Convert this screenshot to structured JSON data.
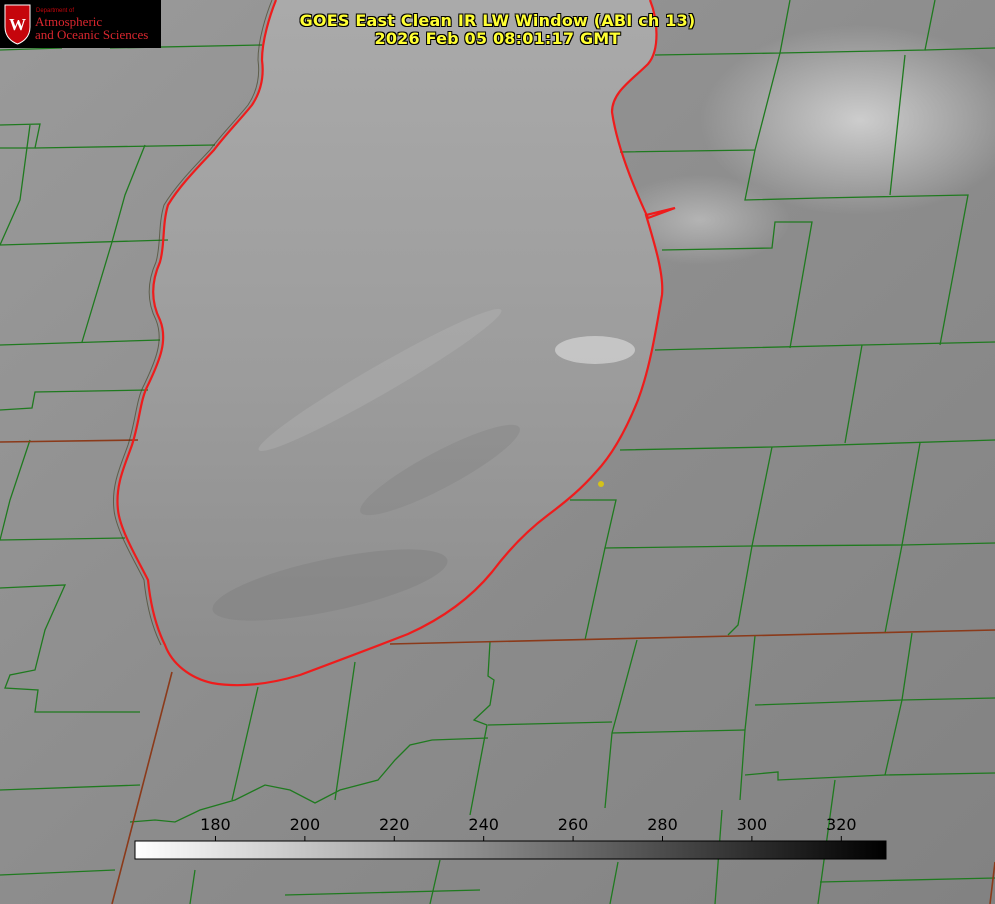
{
  "title": {
    "line1": "GOES East Clean IR LW Window (ABI ch 13)",
    "line2": "2026 Feb 05 08:01:17 GMT"
  },
  "logo": {
    "department": "Department of",
    "line1": "Atmospheric",
    "line2": "and Oceanic Sciences",
    "seal_letter": "W",
    "colors": {
      "background": "#000000",
      "text": "#d9262e",
      "seal": "#c5050c"
    }
  },
  "colorbar": {
    "ticks": [
      "180",
      "200",
      "220",
      "240",
      "260",
      "280",
      "300",
      "320"
    ],
    "min_value": 162,
    "max_value": 330,
    "colors": {
      "low": "#ffffff",
      "high": "#000000"
    }
  },
  "map_colors": {
    "background": "#8a8a8a",
    "lake": "#a2a2a2",
    "county_lines": "#1f7a1f",
    "state_lines": "#8b3a1a",
    "shoreline": "#ee1c1c",
    "marker": "#d4c21a"
  }
}
